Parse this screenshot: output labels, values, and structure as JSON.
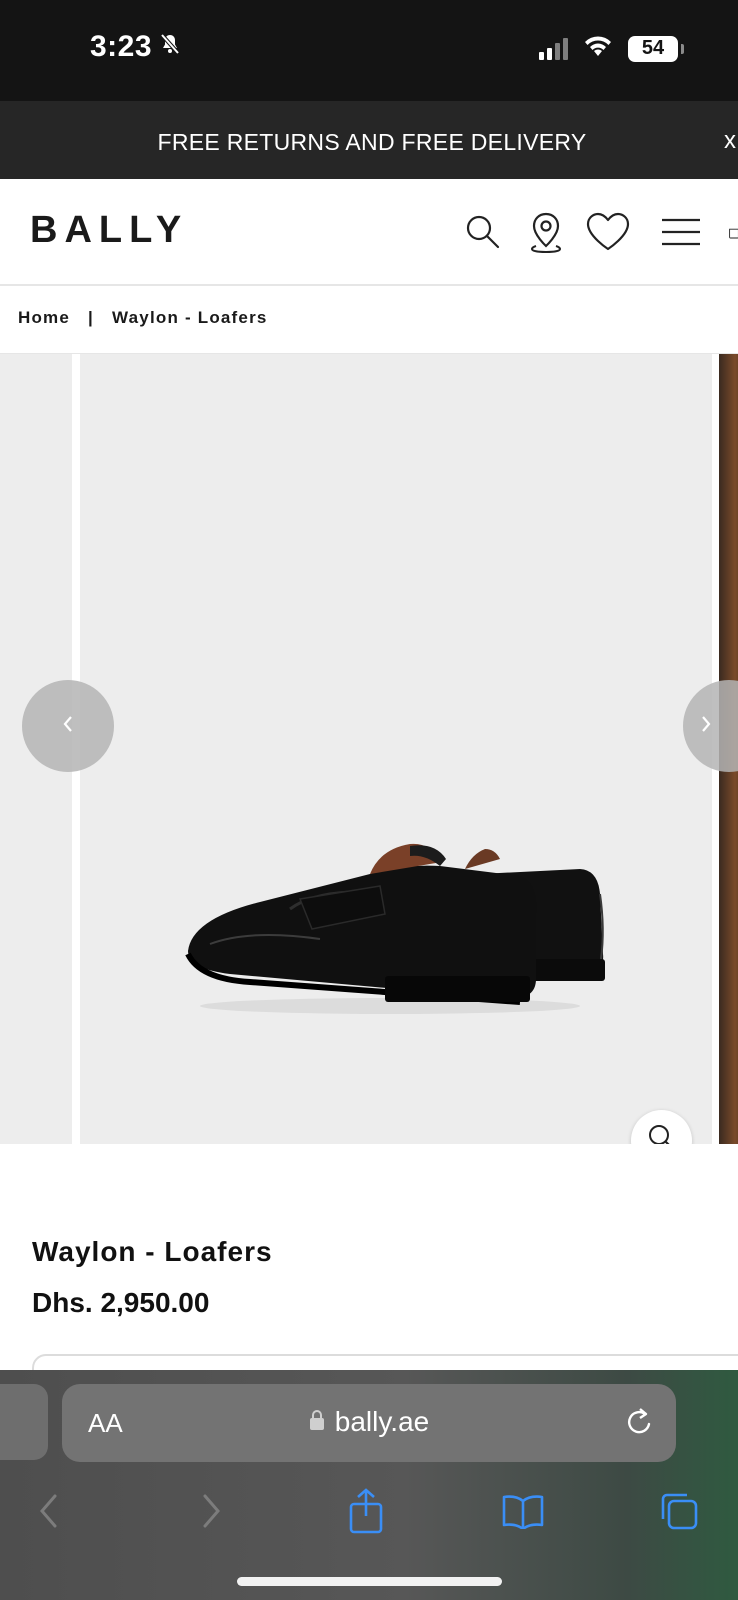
{
  "status_bar": {
    "time": "3:23",
    "battery": "54"
  },
  "promo": {
    "text": "FREE RETURNS AND FREE DELIVERY",
    "close_label": "x"
  },
  "header": {
    "logo": "BALLY"
  },
  "breadcrumb": {
    "home": "Home",
    "separator": "|",
    "current": "Waylon - Loafers"
  },
  "product": {
    "name": "Waylon - Loafers",
    "price": "Dhs. 2,950.00"
  },
  "browser": {
    "text_size_label": "AA",
    "url": "bally.ae"
  },
  "icons": {
    "status": [
      "bell-slash-icon",
      "cellular-signal-icon",
      "wifi-icon",
      "battery-icon"
    ],
    "header": [
      "search-icon",
      "store-locator-icon",
      "wishlist-heart-icon",
      "menu-icon",
      "cart-icon"
    ],
    "carousel": [
      "chevron-left-icon",
      "chevron-right-icon",
      "zoom-icon"
    ],
    "browser": [
      "lock-icon",
      "reload-icon",
      "back-icon",
      "forward-icon",
      "share-icon",
      "bookmarks-icon",
      "tabs-icon"
    ]
  },
  "colors": {
    "status_bar": "#141414",
    "promo_bar": "#262626",
    "image_bg": "#ededed",
    "text": "#111111",
    "safari_blue": "#3a8ef6"
  }
}
